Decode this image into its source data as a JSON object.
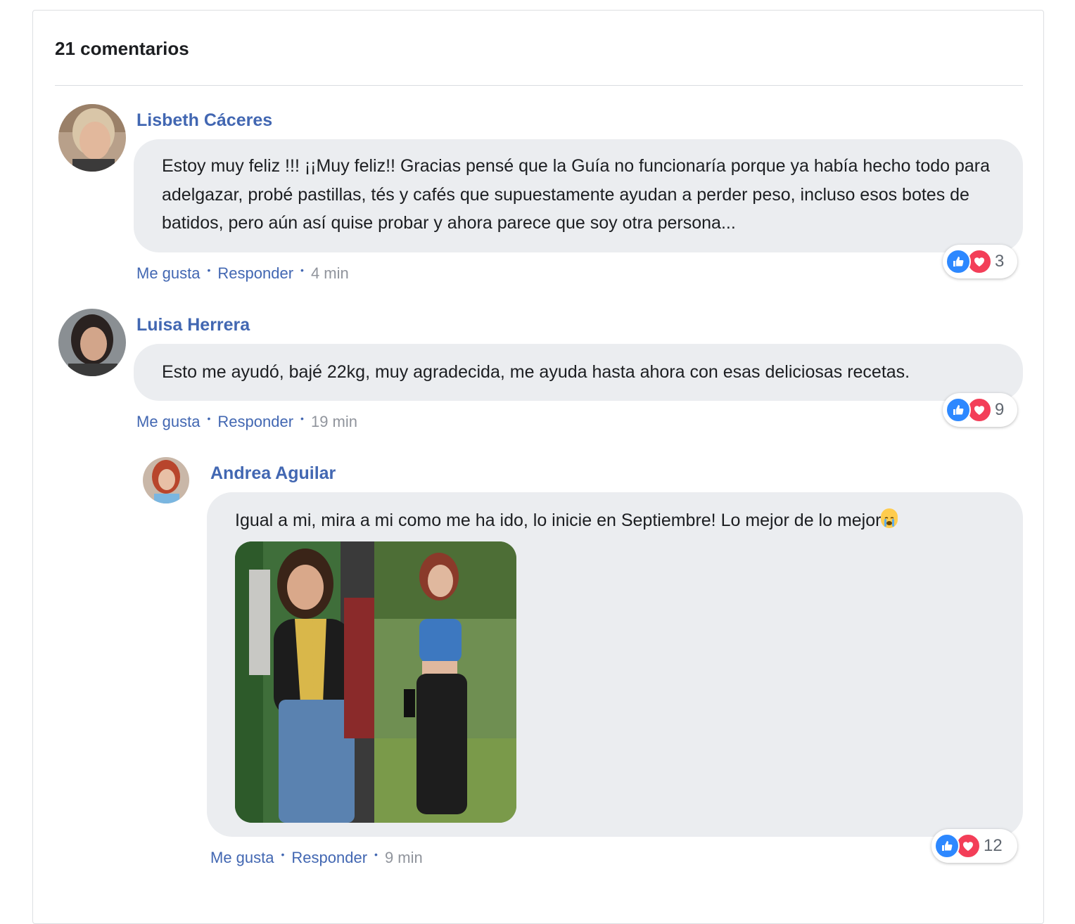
{
  "header": {
    "comment_count": "21 comentarios"
  },
  "colors": {
    "link": "#4267b2",
    "bubble": "#ebedf0",
    "like": "#2d88ff",
    "love": "#f33e58"
  },
  "comments": [
    {
      "author": "Lisbeth Cáceres",
      "text": "Estoy muy feliz !!! ¡¡Muy feliz!! Gracias pensé que la Guía no funcionaría porque ya había hecho todo para adelgazar, probé pastillas, tés y cafés que supuestamente ayudan a perder peso, incluso esos botes de batidos, pero aún así quise probar y ahora parece que soy otra persona...",
      "like_label": "Me gusta",
      "reply_label": "Responder",
      "time": "4 min",
      "reaction_count": "3"
    },
    {
      "author": "Luisa Herrera",
      "text": "Esto me ayudó, bajé 22kg, muy agradecida, me ayuda hasta ahora con esas deliciosas recetas.",
      "like_label": "Me gusta",
      "reply_label": "Responder",
      "time": "19 min",
      "reaction_count": "9",
      "replies": [
        {
          "author": "Andrea Aguilar",
          "text": "Igual a mi, mira a mi como me ha ido, lo inicie en Septiembre! Lo mejor de lo mejor",
          "emoji": "crying-face-emoji",
          "like_label": "Me gusta",
          "reply_label": "Responder",
          "time": "9 min",
          "reaction_count": "12",
          "has_photo": true
        }
      ]
    }
  ]
}
